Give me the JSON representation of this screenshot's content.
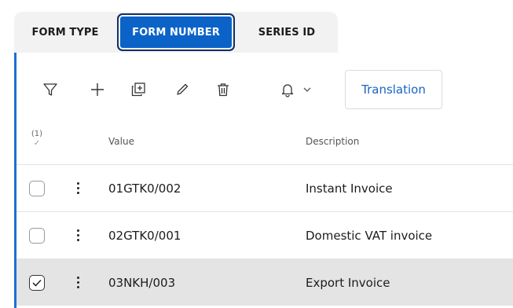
{
  "tabs": [
    {
      "label": "FORM TYPE",
      "active": false
    },
    {
      "label": "FORM NUMBER",
      "active": true
    },
    {
      "label": "SERIES ID",
      "active": false
    }
  ],
  "toolbar": {
    "icons": [
      "filter-icon",
      "add-icon",
      "copy-icon",
      "edit-icon",
      "delete-icon",
      "bell-icon",
      "chevron-down-icon"
    ],
    "translation_label": "Translation"
  },
  "table": {
    "selection_count": "(1)",
    "columns": [
      "Value",
      "Description"
    ],
    "rows": [
      {
        "value": "01GTK0/002",
        "description": "Instant Invoice",
        "checked": false
      },
      {
        "value": "02GTK0/001",
        "description": "Domestic VAT invoice",
        "checked": false
      },
      {
        "value": "03NKH/003",
        "description": "Export Invoice",
        "checked": true
      }
    ]
  },
  "colors": {
    "accent": "#0b63c8",
    "panel_border": "#1f6fd1",
    "selected_row": "#e4e4e4",
    "link": "#1a64c4"
  }
}
